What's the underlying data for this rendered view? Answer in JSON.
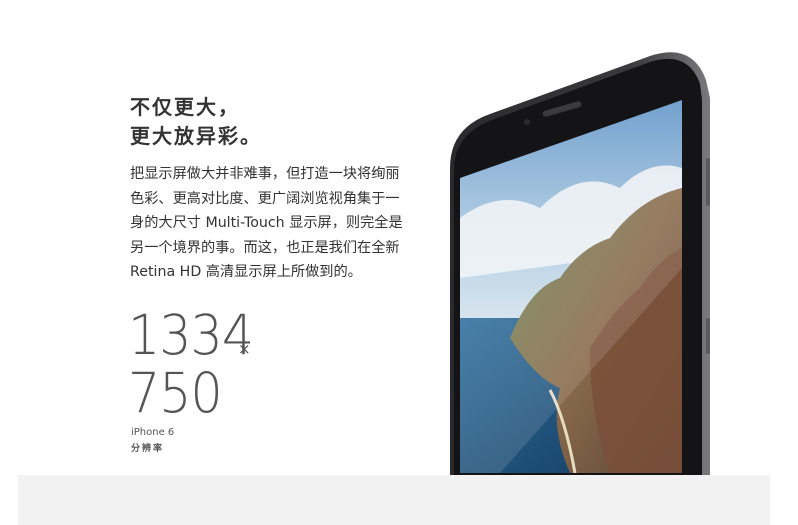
{
  "headline": {
    "line1": "不仅更大，",
    "line2": "更大放异彩。"
  },
  "body_lines": [
    "把显示屏做大并非难事，但打造一块将绚丽",
    "色彩、更高对比度、更广阔浏览视角集于一",
    "身的大尺寸 Multi-Touch 显示屏，则完全是",
    "另一个境界的事。而这，也正是我们在全新",
    "Retina HD 高清显示屏上所做到的。"
  ],
  "resolution": {
    "width": "1334",
    "times": "×",
    "height": "750"
  },
  "model": {
    "name": "iPhone 6",
    "caption": "分辨率"
  },
  "colors": {
    "text": "#333333",
    "phone_body": "#1c1c1e",
    "footer_band": "#f2f2f2"
  }
}
